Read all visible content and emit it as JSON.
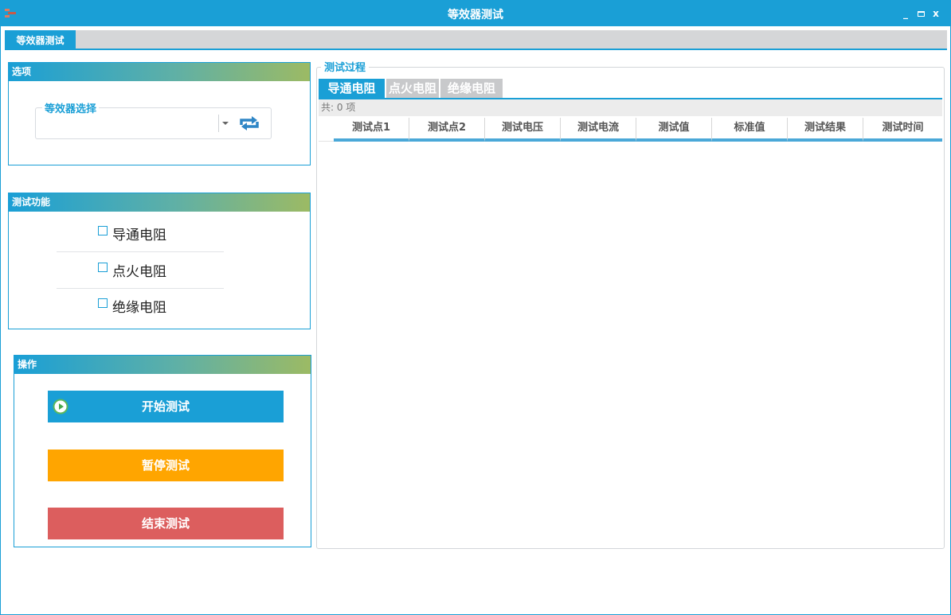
{
  "window": {
    "title": "等效器测试",
    "controls": {
      "minimize": "_",
      "maximize": "",
      "close": "x"
    }
  },
  "top_tabs": [
    {
      "label": "等效器测试",
      "active": true
    }
  ],
  "options": {
    "header": "选项",
    "selector_legend": "等效器选择",
    "selector_value": "",
    "refresh_icon": "refresh-icon"
  },
  "functions": {
    "header": "测试功能",
    "items": [
      {
        "label": "导通电阻",
        "checked": false
      },
      {
        "label": "点火电阻",
        "checked": false
      },
      {
        "label": "绝缘电阻",
        "checked": false
      }
    ]
  },
  "actions": {
    "header": "操作",
    "start_label": "开始测试",
    "pause_label": "暂停测试",
    "stop_label": "结束测试"
  },
  "process": {
    "legend": "测试过程",
    "tabs": [
      {
        "label": "导通电阻",
        "active": true
      },
      {
        "label": "点火电阻",
        "active": false
      },
      {
        "label": "绝缘电阻",
        "active": false
      }
    ],
    "count_text": "共: 0 项",
    "columns": [
      "测试点1",
      "测试点2",
      "测试电压",
      "测试电流",
      "测试值",
      "标准值",
      "测试结果",
      "测试时间"
    ],
    "rows": []
  },
  "colors": {
    "accent": "#1a9fd6",
    "start": "#1a9fd6",
    "pause": "#ffa500",
    "stop": "#dc5e5e"
  }
}
